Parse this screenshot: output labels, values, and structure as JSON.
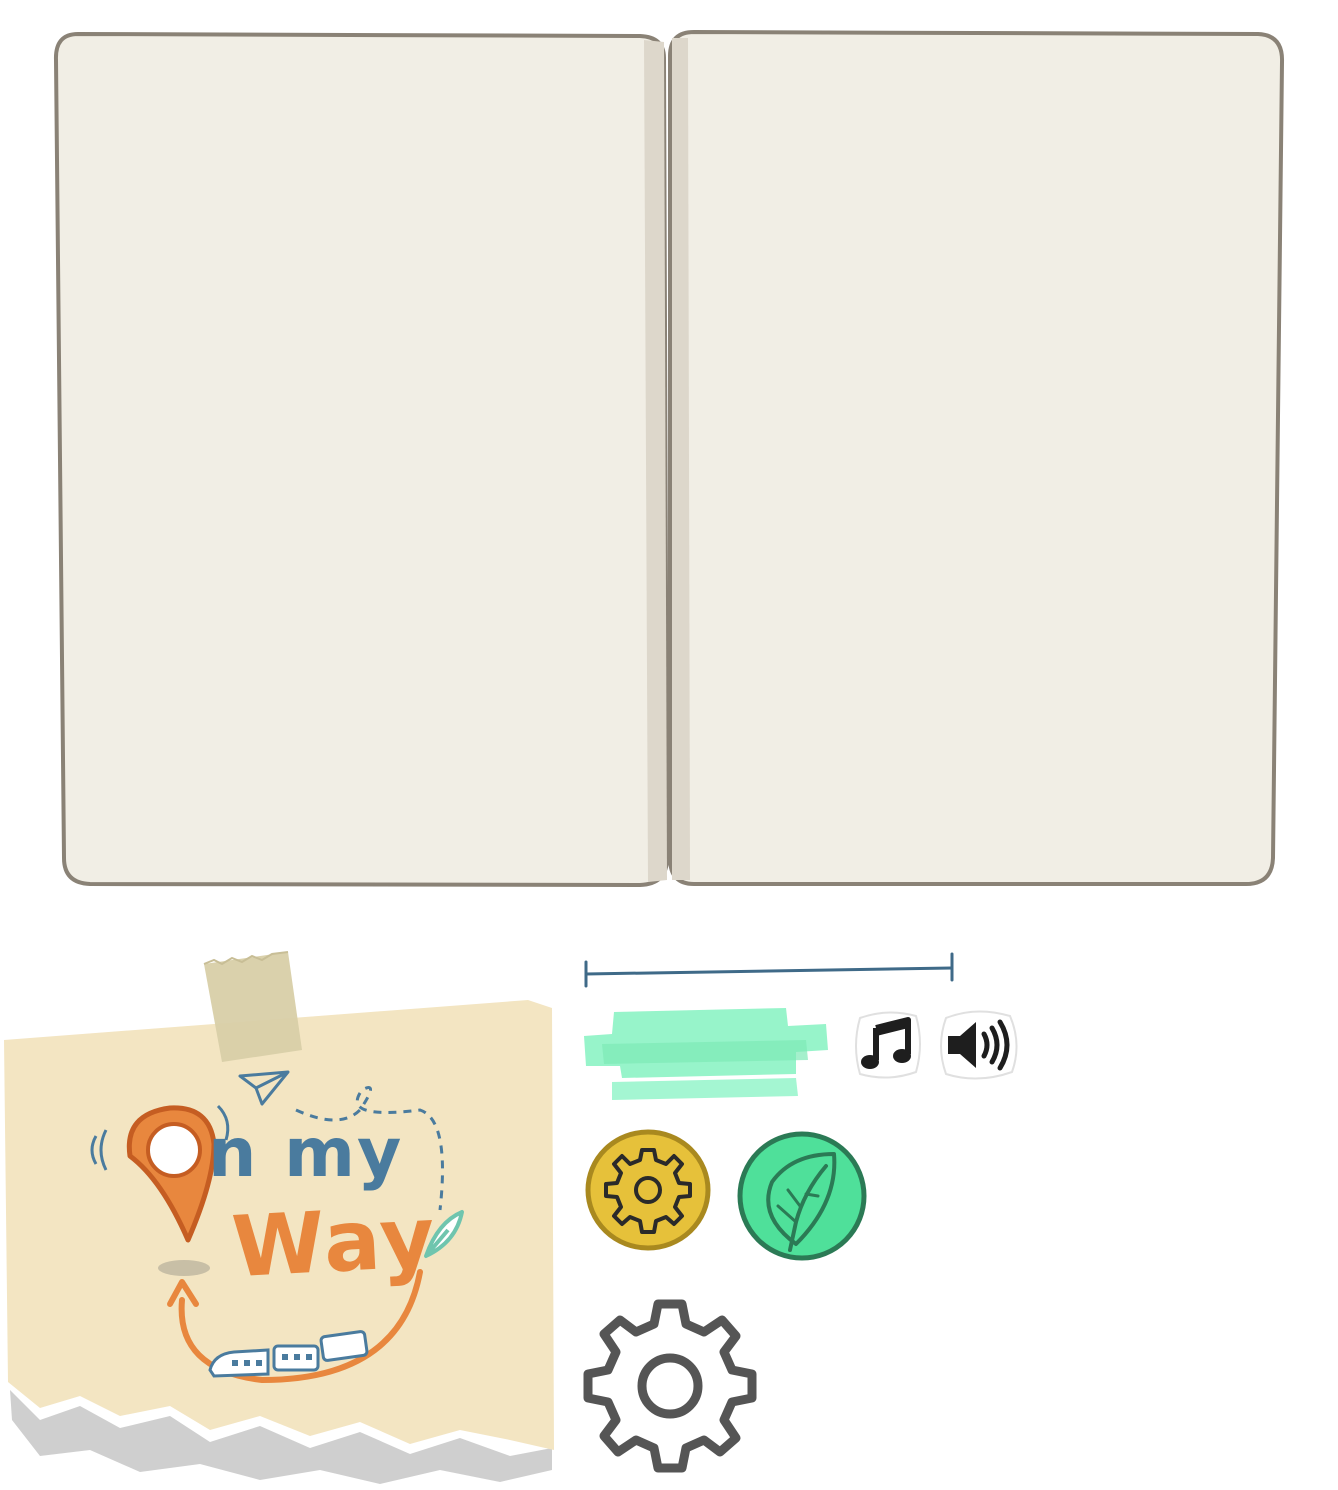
{
  "logo": {
    "line1": "n my",
    "line2": "Way"
  },
  "icons": {
    "music": "music-note-icon",
    "sound": "speaker-volume-icon",
    "settings_small": "gear-icon",
    "nature": "leaf-icon",
    "settings_large": "gear-icon"
  },
  "colors": {
    "page": "#f1eee5",
    "page_border": "#8a8276",
    "spine": "#ddd7cb",
    "note": "#f3e5c2",
    "tape": "#d8cfa8",
    "orange": "#e8873e",
    "orange_dark": "#c55d22",
    "blue": "#4a7b9e",
    "teal": "#6fc5ae",
    "slider_green": "#8cf3c4",
    "slider_line": "#3f6a88",
    "gear_yellow": "#e6c13a",
    "leaf_green": "#4fe09a",
    "gray": "#555555"
  }
}
